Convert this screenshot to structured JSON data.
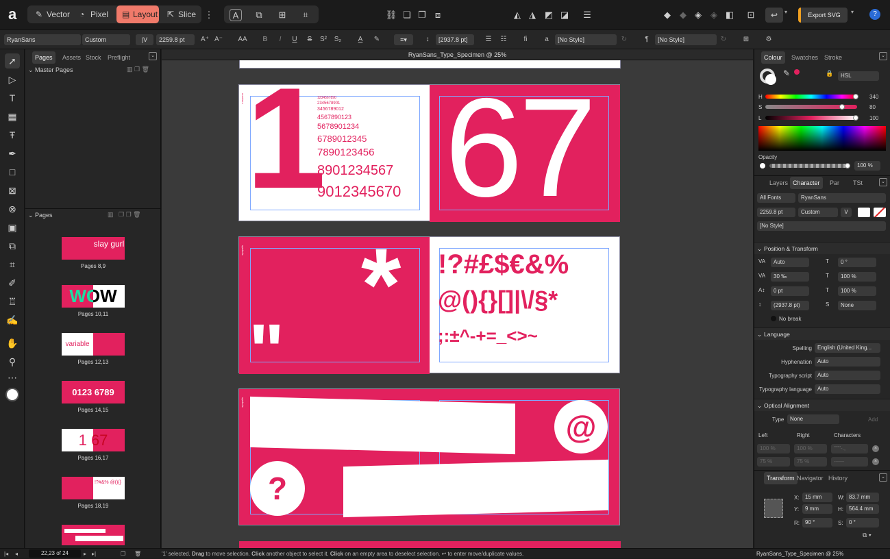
{
  "colors": {
    "accent": "#f07a6a",
    "magenta": "#e2215e",
    "canvas": "#3a3a3a"
  },
  "personas": [
    {
      "label": "Vector",
      "icon": "pen-icon"
    },
    {
      "label": "Pixel",
      "icon": "brush-icon"
    },
    {
      "label": "Layout",
      "icon": "layout-icon"
    },
    {
      "label": "Slice",
      "icon": "slice-icon"
    }
  ],
  "toolbar": {
    "export_label": "Export SVG",
    "help": "?"
  },
  "context": {
    "font": "RyanSans",
    "style": "Custom",
    "size": "2259.8 pt",
    "leading": "[2937.8 pt]",
    "paragraph_style": "[No Style]",
    "char_style": "[No Style]",
    "aa": "AA",
    "b": "B",
    "i": "I",
    "u": "U",
    "s": "S",
    "ss": "S²",
    "sub": "S₂",
    "fi": "fi",
    "a": "a",
    "pilcrow": "¶"
  },
  "docTitle": "RyanSans_Type_Specimen @ 25%",
  "left": {
    "tabs": [
      "Pages",
      "Assets",
      "Stock",
      "Preflight"
    ],
    "master_pages": "Master Pages",
    "pages": "Pages",
    "thumbs": [
      {
        "label": "Pages 8,9",
        "text": "slay gurl"
      },
      {
        "label": "Pages 10,11",
        "text": "WOW"
      },
      {
        "label": "Pages 12,13",
        "text": "variable"
      },
      {
        "label": "Pages 14,15",
        "text": "0123 6789"
      },
      {
        "label": "Pages 16,17",
        "text": "1 67"
      },
      {
        "label": "Pages 18,19",
        "text": "!?#&% @(){}"
      }
    ]
  },
  "spreads": {
    "a": {
      "big_left": "1",
      "big_right": "67",
      "lines": [
        "1234567890",
        "2345678901",
        "3456789012",
        "4567890123",
        "5678901234",
        "6789012345",
        "7890123456",
        "8901234567",
        "9012345670"
      ],
      "side": "numbers"
    },
    "b": {
      "star": "*",
      "quote": "\"",
      "g1": "!?#£$€&%",
      "g2": "@(){}[]|\\/§*",
      "g3": ";:±^-+=_<>~",
      "side": "symbols"
    },
    "c": {
      "at": "@",
      "q": "?",
      "side": "symbols"
    }
  },
  "right": {
    "tabs1": [
      "Colour",
      "Swatches",
      "Stroke"
    ],
    "model": "HSL",
    "h_label": "H",
    "s_label": "S",
    "l_label": "L",
    "h": "340",
    "s": "80",
    "l": "100",
    "opacity_label": "Opacity",
    "opacity": "100 %",
    "tabs2": [
      "Layers",
      "Character",
      "Par",
      "TSt"
    ],
    "all_fonts": "All Fonts",
    "font": "RyanSans",
    "size": "2259.8 pt",
    "style": "Custom",
    "no_style": "[No Style]",
    "pos_title": "Position & Transform",
    "kern": "Auto",
    "rot": "0 °",
    "track": "30 ‰",
    "hscale": "100 %",
    "baseline": "0 pt",
    "vscale": "100 %",
    "lead": "(2937.8 pt)",
    "none": "None",
    "nobreak": "No break",
    "lang_title": "Language",
    "spelling_l": "Spelling",
    "spelling": "English (United King...",
    "hyph_l": "Hyphenation",
    "hyph": "Auto",
    "script_l": "Typography script",
    "script": "Auto",
    "tlang_l": "Typography language",
    "tlang": "Auto",
    "opt_title": "Optical Alignment",
    "type_l": "Type",
    "type": "None",
    "add": "Add",
    "left": "Left",
    "right_l": "Right",
    "chars": "Characters",
    "r1a": "100 %",
    "r1b": "100 %",
    "r1c": "\"'\"\"-.,",
    "r2a": "75 %",
    "r2b": "75 %",
    "r2c": "-–—",
    "tabs3": [
      "Transform",
      "Navigator",
      "History"
    ],
    "x_l": "X:",
    "x": "15 mm",
    "y_l": "Y:",
    "y": "9 mm",
    "w_l": "W:",
    "w": "83.7 mm",
    "hh_l": "H:",
    "hh": "564.4 mm",
    "r_l": "R:",
    "r": "90 °",
    "s_l": "S:",
    "sk": "0 °"
  },
  "status": {
    "page": "22,23 of 24",
    "msg_a": "'1' selected. ",
    "msg_b": "Drag",
    "msg_c": " to move selection. ",
    "msg_d": "Click",
    "msg_e": " another object to select it. ",
    "msg_f": "Click",
    "msg_g": " on an empty area to deselect selection. ↩ to enter move/duplicate values.",
    "doc": "RyanSans_Type_Specimen @ 25%"
  }
}
